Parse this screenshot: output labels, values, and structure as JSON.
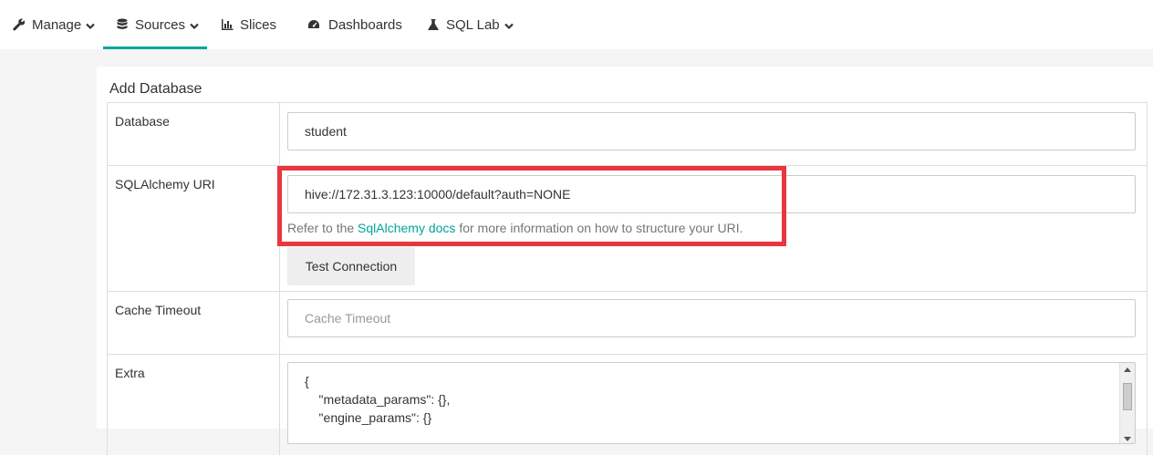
{
  "nav": {
    "manage": "Manage",
    "sources": "Sources",
    "slices": "Slices",
    "dashboards": "Dashboards",
    "sql_lab": "SQL Lab",
    "active_color": "#00a699"
  },
  "form": {
    "title": "Add Database",
    "database": {
      "label": "Database",
      "value": "student"
    },
    "sqlalchemy_uri": {
      "label": "SQLAlchemy URI",
      "value": "hive://172.31.3.123:10000/default?auth=NONE",
      "help_before": "Refer to the ",
      "help_link": "SqlAlchemy docs",
      "help_after": " for more information on how to structure your URI.",
      "test_button": "Test Connection"
    },
    "cache_timeout": {
      "label": "Cache Timeout",
      "placeholder": "Cache Timeout"
    },
    "extra": {
      "label": "Extra",
      "lines": [
        "{",
        "    \"metadata_params\": {},",
        "    \"engine_params\": {}"
      ]
    }
  },
  "annotation": {
    "highlight_color": "#e8373d"
  }
}
